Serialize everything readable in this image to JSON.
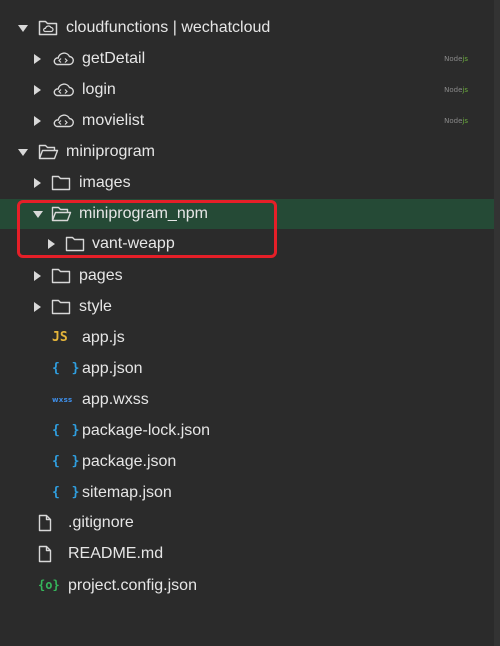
{
  "tree": {
    "items": [
      {
        "label": "cloudfunctions | wechatcloud",
        "icon": "cloud-folder-icon",
        "expanded": true,
        "badge": null
      },
      {
        "label": "getDetail",
        "icon": "cloud-function-icon",
        "expanded": false,
        "badge": {
          "node": "Node",
          "js": "js"
        }
      },
      {
        "label": "login",
        "icon": "cloud-function-icon",
        "expanded": false,
        "badge": {
          "node": "Node",
          "js": "js"
        }
      },
      {
        "label": "movielist",
        "icon": "cloud-function-icon",
        "expanded": false,
        "badge": {
          "node": "Node",
          "js": "js"
        }
      },
      {
        "label": "miniprogram",
        "icon": "folder-open-icon",
        "expanded": true
      },
      {
        "label": "images",
        "icon": "folder-icon",
        "expanded": false
      },
      {
        "label": "miniprogram_npm",
        "icon": "folder-open-icon",
        "expanded": true,
        "selected": true
      },
      {
        "label": "vant-weapp",
        "icon": "folder-icon",
        "expanded": false
      },
      {
        "label": "pages",
        "icon": "folder-icon",
        "expanded": false
      },
      {
        "label": "style",
        "icon": "folder-icon",
        "expanded": false
      },
      {
        "label": "app.js",
        "icon": "js-file-icon",
        "icon_text": "JS"
      },
      {
        "label": "app.json",
        "icon": "json-file-icon",
        "icon_text": "{ }"
      },
      {
        "label": "app.wxss",
        "icon": "wxss-file-icon",
        "icon_text": "wxss"
      },
      {
        "label": "package-lock.json",
        "icon": "json-file-icon",
        "icon_text": "{ }"
      },
      {
        "label": "package.json",
        "icon": "json-file-icon",
        "icon_text": "{ }"
      },
      {
        "label": "sitemap.json",
        "icon": "json-file-icon",
        "icon_text": "{ }"
      },
      {
        "label": ".gitignore",
        "icon": "file-icon"
      },
      {
        "label": "README.md",
        "icon": "file-icon"
      },
      {
        "label": "project.config.json",
        "icon": "config-file-icon",
        "icon_text": "{o}"
      }
    ]
  },
  "colors": {
    "background": "#2b2b2b",
    "selected_row": "#254a36",
    "highlight_border": "#e51f28",
    "js_icon": "#e5b53a",
    "json_icon": "#2f9fe0",
    "wxss_icon": "#3e8de6",
    "config_icon": "#35b55a"
  }
}
